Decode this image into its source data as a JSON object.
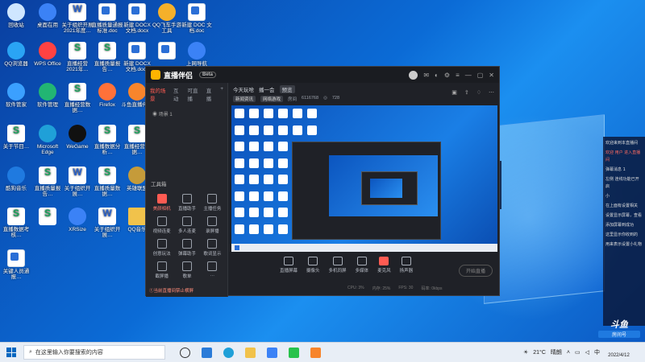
{
  "desktop": {
    "icons": [
      {
        "label": "回收站",
        "kind": "round",
        "color": "#cfe6ff"
      },
      {
        "label": "桌面在用",
        "kind": "round",
        "color": "#3b82f6"
      },
      {
        "label": "关于组织开展2021年度…",
        "kind": "wordw",
        "color": "#fff"
      },
      {
        "label": "直播质量通报标准.doc",
        "kind": "doc",
        "color": "#fff"
      },
      {
        "label": "新建 DOCX 文档.docx",
        "kind": "doc",
        "color": "#fff"
      },
      {
        "label": "QQ飞车手游工具",
        "kind": "round",
        "color": "#f5b02a"
      },
      {
        "label": "新建 DOC 文档.doc",
        "kind": "doc",
        "color": "#fff"
      },
      {
        "label": "QQ浏览器",
        "kind": "round",
        "color": "#2aa4f4"
      },
      {
        "label": "WPS Office",
        "kind": "round",
        "color": "#ff4242"
      },
      {
        "label": "直播经营2021年…",
        "kind": "wps",
        "color": "#fff"
      },
      {
        "label": "直播质量报告…",
        "kind": "wps",
        "color": "#fff"
      },
      {
        "label": "新建 DOCX 文档.docx",
        "kind": "doc",
        "color": "#fff"
      },
      {
        "label": "",
        "kind": "doc",
        "color": "#fff"
      },
      {
        "label": "上网导航",
        "kind": "round",
        "color": "#3b82f6"
      },
      {
        "label": "软件管家",
        "kind": "round",
        "color": "#3ba0ff"
      },
      {
        "label": "软件管理",
        "kind": "round",
        "color": "#22b573"
      },
      {
        "label": "直播经营数据…",
        "kind": "wps",
        "color": "#fff"
      },
      {
        "label": "Firefox",
        "kind": "round",
        "color": "#ff7139"
      },
      {
        "label": "斗鱼直播伴侣",
        "kind": "round",
        "color": "#f7852c"
      },
      {
        "label": "此电脑",
        "kind": "doc",
        "color": "#8ec5ff"
      },
      {
        "label": "确保作品上传…",
        "kind": "wps",
        "color": "#fff"
      },
      {
        "label": "关于节目…",
        "kind": "wps",
        "color": "#fff"
      },
      {
        "label": "Microsoft Edge",
        "kind": "round",
        "color": "#1fa0d8"
      },
      {
        "label": "WeGame",
        "kind": "round",
        "color": "#111"
      },
      {
        "label": "直播数据分析…",
        "kind": "wps",
        "color": "#fff"
      },
      {
        "label": "直播经营数据…",
        "kind": "wps",
        "color": "#fff"
      },
      {
        "label": "直播质量…",
        "kind": "wps",
        "color": "#fff"
      },
      {
        "label": "Steam",
        "kind": "round",
        "color": "#2a3f5a"
      },
      {
        "label": "酷狗音乐",
        "kind": "round",
        "color": "#1f7ae0"
      },
      {
        "label": "直播质量报告…",
        "kind": "wps",
        "color": "#fff"
      },
      {
        "label": "关于组织开展…",
        "kind": "wordw",
        "color": "#fff"
      },
      {
        "label": "直播质量数据…",
        "kind": "wps",
        "color": "#fff"
      },
      {
        "label": "英雄联盟",
        "kind": "round",
        "color": "#c59b3a"
      },
      {
        "label": "微信",
        "kind": "round",
        "color": "#27c24c"
      },
      {
        "label": "",
        "kind": "folder",
        "color": "#f1c24b"
      },
      {
        "label": "直播数据考核…",
        "kind": "wps",
        "color": "#fff"
      },
      {
        "label": "",
        "kind": "wps",
        "color": "#fff"
      },
      {
        "label": "XRSize",
        "kind": "round",
        "color": "#3b82f6"
      },
      {
        "label": "关于组织开展…",
        "kind": "wordw",
        "color": "#fff"
      },
      {
        "label": "QQ音乐",
        "kind": "folder",
        "color": "#f1c24b"
      },
      {
        "label": "2021年度…",
        "kind": "wps",
        "color": "#fff"
      },
      {
        "label": "QQ飞车",
        "kind": "round",
        "color": "#f5b02a"
      },
      {
        "label": "关键人员通报…",
        "kind": "doc",
        "color": "#fff"
      }
    ]
  },
  "app": {
    "title": "直播伴侣",
    "version": "Beta",
    "left_tabs": [
      "我的场景",
      "互动",
      "可直播",
      "直播"
    ],
    "scene_label": "场景 1",
    "tools_title": "工具箱",
    "tools": [
      "美颜相机",
      "直播助手",
      "主播任务",
      "视频连麦",
      "多人连麦",
      "录屏播",
      "创意玩法",
      "弹幕助手",
      "歌词显示",
      "截屏播",
      "歌单",
      "…"
    ],
    "banner": "①当前直播间禁止横屏",
    "room_title": "今天玩啥",
    "room_sub": "播一会",
    "room_btn": "预览",
    "room_tags": [
      "新闻资讯",
      "网络游戏"
    ],
    "room_id_label": "房间",
    "room_id": "6116768",
    "viewers": "728",
    "bottom_tools": [
      "直播屏幕",
      "摄像头",
      "多机同屏",
      "多媒体",
      "麦克风",
      "扬声器"
    ],
    "go_live": "开始直播",
    "status": [
      "CPU: 3%",
      "内存: 25%",
      "FPS: 30",
      "码率: 0kbps"
    ]
  },
  "sidepanel": {
    "lines": [
      {
        "text": "欢迎来到本直播间",
        "red": false
      },
      {
        "text": "欢迎 用户 进入直播间",
        "red": true
      },
      {
        "text": "弹幕消息 1",
        "red": false
      },
      {
        "text": "左侧 连线功能已开启",
        "red": false
      },
      {
        "text": "小",
        "red": false
      },
      {
        "text": "在上面有设置相关",
        "red": false
      },
      {
        "text": "设置显示屏幕，查看",
        "red": false
      },
      {
        "text": "添加屏幕到成功",
        "red": false
      },
      {
        "text": "这里显示你收到的",
        "red": false
      },
      {
        "text": "用来表示设置小礼物",
        "red": false
      }
    ]
  },
  "watermark": {
    "brand": "斗鱼",
    "sub": "房间号"
  },
  "taskbar": {
    "search_placeholder": "在这里输入你要搜索的内容",
    "tray": {
      "temp": "21°C",
      "weather": "晴朗",
      "ime": "中",
      "date": "2022/4/12"
    }
  },
  "colors": {
    "accent": "#ff5b52",
    "taskbar": "#e8eef6"
  }
}
